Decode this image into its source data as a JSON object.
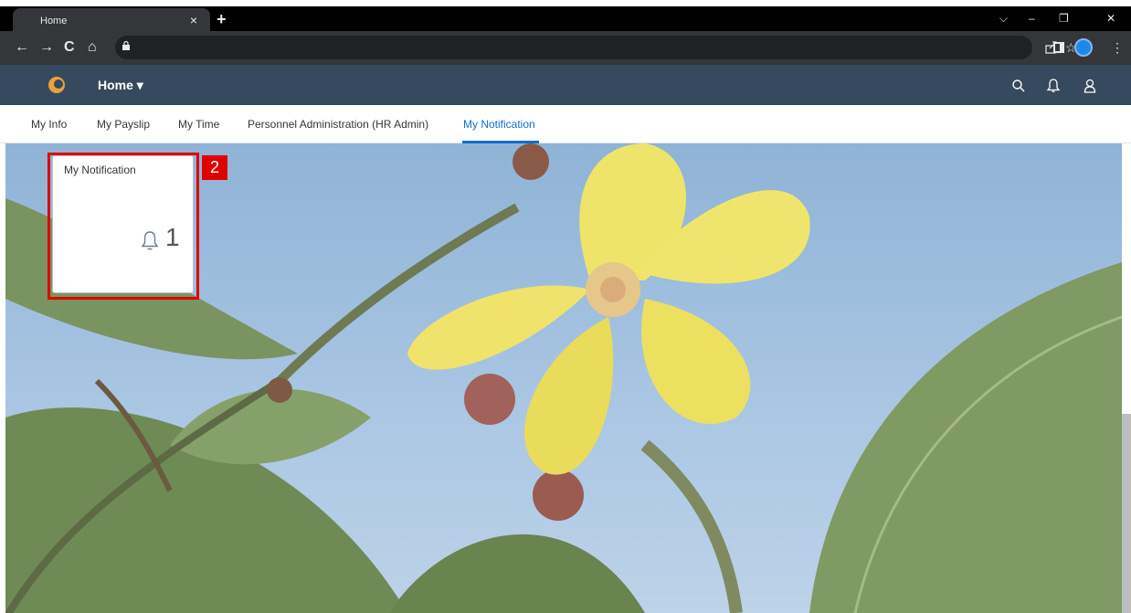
{
  "browser": {
    "tab_title": "Home",
    "tab_close": "×",
    "new_tab": "+",
    "window_controls": {
      "dropdown": "⌵",
      "minimize": "–",
      "restore": "❐",
      "close": "✕"
    }
  },
  "toolbar": {
    "back": "←",
    "forward": "→",
    "reload": "C",
    "home": "⌂",
    "bookmark": "☆",
    "menu": "⋮"
  },
  "shell": {
    "title": "Home",
    "title_caret": "▾",
    "icons": [
      "search-icon",
      "bell-icon",
      "user-icon"
    ]
  },
  "page_tabs": [
    {
      "label": "My Info"
    },
    {
      "label": "My Payslip"
    },
    {
      "label": "My Time"
    },
    {
      "label": "Personnel Administration (HR Admin)"
    },
    {
      "label": "My Notification",
      "active": true
    }
  ],
  "tile": {
    "title": "My Notification",
    "count": "1",
    "icon": "bell-icon"
  },
  "annotation": {
    "step": "2"
  },
  "colors": {
    "shell_bg": "#354a5f",
    "active_tab": "#0a6ed1",
    "highlight": "#e00000"
  }
}
